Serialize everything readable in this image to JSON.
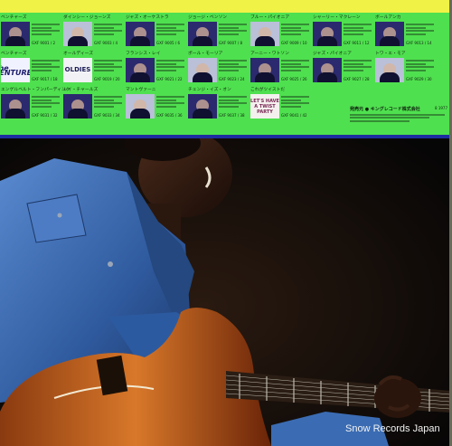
{
  "catalog": {
    "items": [
      {
        "id": "c1",
        "title": "ベンチャーズ",
        "kind": "photo",
        "cat": "GXF 9001 / 2"
      },
      {
        "id": "c2",
        "title": "ダインシー・ジョーンズ",
        "kind": "photo",
        "cat": "GXF 9003 / 4"
      },
      {
        "id": "c3",
        "title": "ジャズ・オーケストラ",
        "kind": "photo",
        "cat": "GXF 9005 / 6"
      },
      {
        "id": "c4",
        "title": "ジョージ・ベンソン",
        "kind": "photo",
        "cat": "GXF 9007 / 8"
      },
      {
        "id": "c5",
        "title": "ブルー・パイオニア",
        "kind": "photo",
        "cat": "GXF 9009 / 10"
      },
      {
        "id": "c6",
        "title": "シャーリー・マクレーン",
        "kind": "photo",
        "cat": "GXF 9011 / 12"
      },
      {
        "id": "c7",
        "title": "ボールアンカ",
        "kind": "photo",
        "cat": "GXF 9013 / 14"
      },
      {
        "id": "c8",
        "title": "ベンチャーズ",
        "kind": "ventures",
        "thumb_text": "The VENTURES",
        "cat": "GXF 9017 / 18"
      },
      {
        "id": "c9",
        "title": "オールディーズ",
        "kind": "oldies",
        "thumb_text": "OLDIES",
        "cat": "GXF 9019 / 20"
      },
      {
        "id": "c10",
        "title": "フランシス・レイ",
        "kind": "photo",
        "cat": "GXF 9021 / 22"
      },
      {
        "id": "c11",
        "title": "ポール・モーリア",
        "kind": "photo",
        "cat": "GXF 9023 / 24"
      },
      {
        "id": "c12",
        "title": "アーニー・ワトソン",
        "kind": "photo",
        "cat": "GXF 9025 / 26"
      },
      {
        "id": "c13",
        "title": "ジャズ・パイオニア",
        "kind": "photo",
        "cat": "GXF 9027 / 28"
      },
      {
        "id": "c14",
        "title": "トワ・エ・モア",
        "kind": "photo",
        "cat": "GXF 9029 / 30"
      },
      {
        "id": "c15",
        "title": "エンゲルベルト・フンパーディンク",
        "kind": "photo",
        "cat": "GXF 9031 / 32"
      },
      {
        "id": "c16",
        "title": "レイ・チャールズ",
        "kind": "photo",
        "cat": "GXF 9033 / 34"
      },
      {
        "id": "c17",
        "title": "マントヴァーニ",
        "kind": "photo",
        "cat": "GXF 9035 / 36"
      },
      {
        "id": "c18",
        "title": "チェンジ・イズ・オン",
        "kind": "photo",
        "cat": "GXF 9037 / 38"
      },
      {
        "id": "c19",
        "title": "これがツイストだ",
        "kind": "party",
        "thumb_text": "LET'S HAVE A TWIST PARTY",
        "cat": "GXF 9041 / 42"
      }
    ]
  },
  "label": {
    "company": "発売元 ● キングレコード株式会社",
    "code": "8 1977"
  },
  "watermark": {
    "text": "Snow Records Japan"
  },
  "colors": {
    "banner": "#4fe04f",
    "banner_border": "#1d2fa0",
    "top_strip": "#f0f246",
    "background": "#0d0b0a",
    "denim": "#3a68b0",
    "guitar": "#c25a1e"
  }
}
